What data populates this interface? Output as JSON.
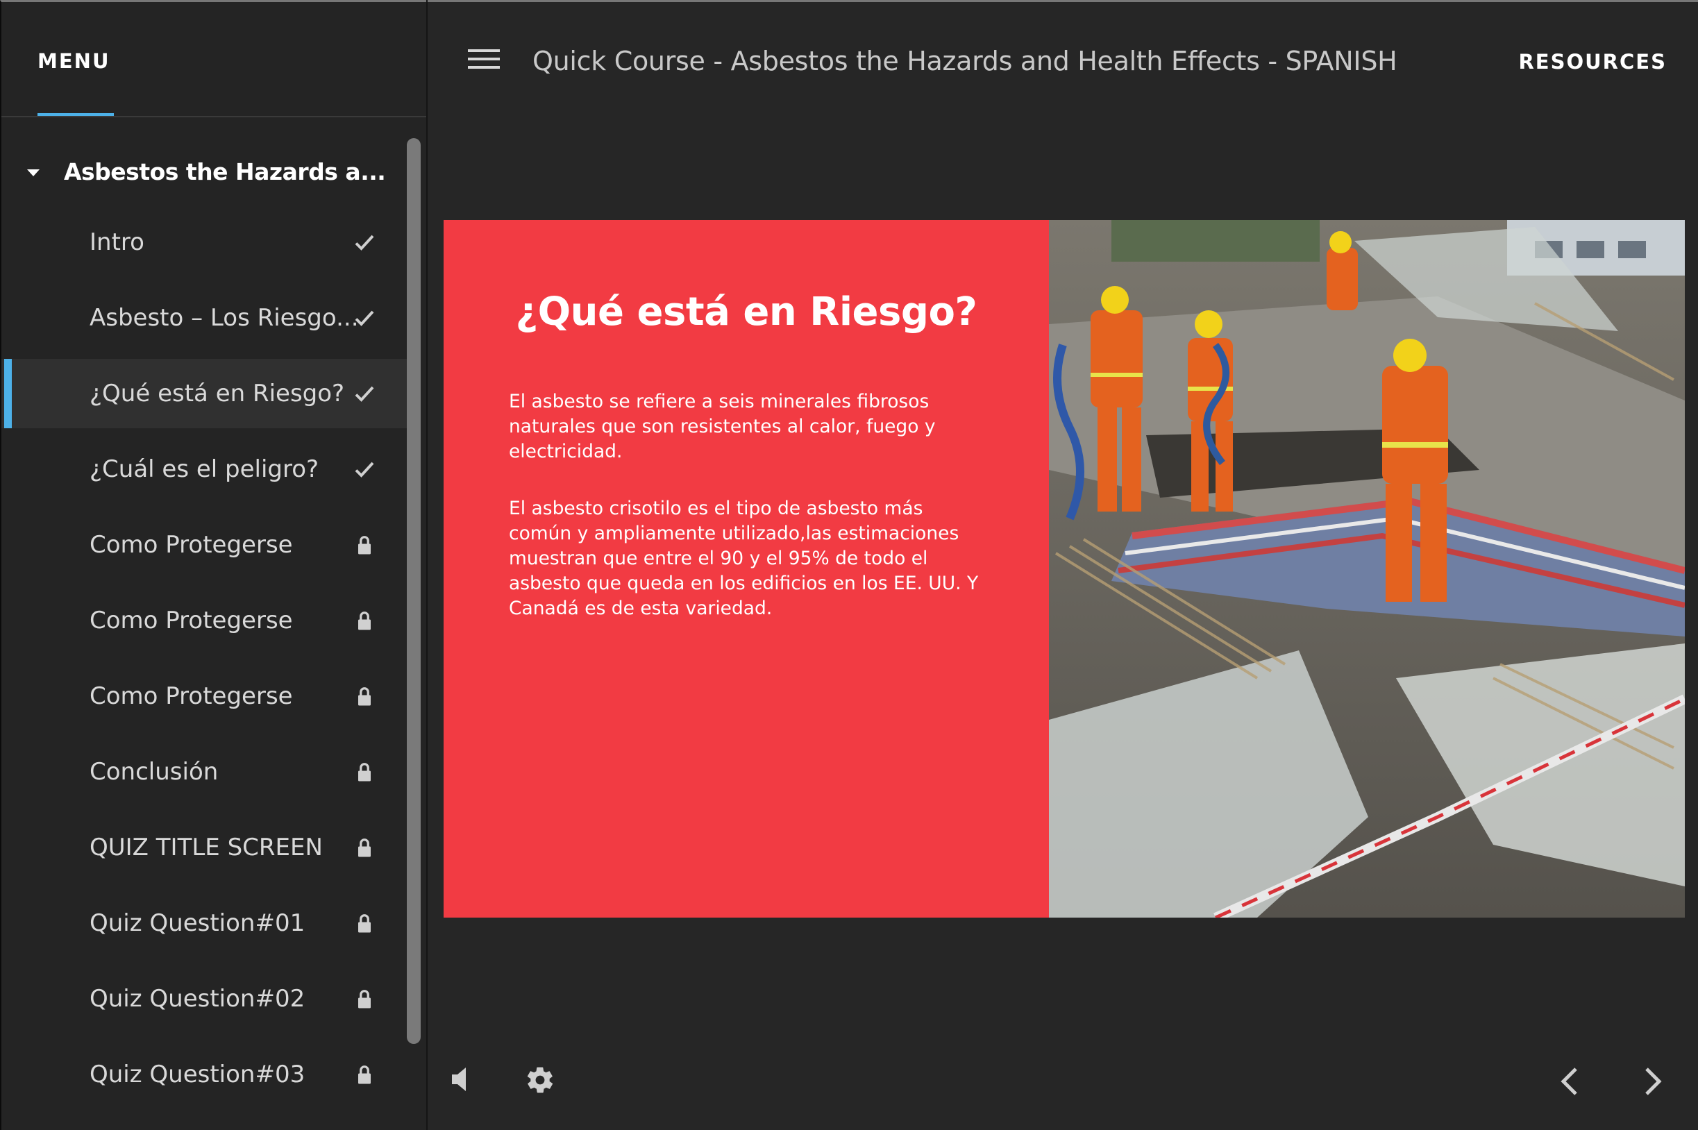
{
  "sidebar": {
    "menu_tab": "MENU",
    "section_title": "Asbestos the Hazards a...",
    "items": [
      {
        "label": "Intro",
        "status": "complete"
      },
      {
        "label": "Asbesto – Los Riesgo...",
        "status": "complete"
      },
      {
        "label": "¿Qué está en Riesgo?",
        "status": "complete"
      },
      {
        "label": "¿Cuál es el peligro?",
        "status": "complete"
      },
      {
        "label": "Como Protegerse",
        "status": "locked"
      },
      {
        "label": "Como Protegerse",
        "status": "locked"
      },
      {
        "label": "Como Protegerse",
        "status": "locked"
      },
      {
        "label": "Conclusión",
        "status": "locked"
      },
      {
        "label": "QUIZ TITLE SCREEN",
        "status": "locked"
      },
      {
        "label": "Quiz Question#01",
        "status": "locked"
      },
      {
        "label": "Quiz Question#02",
        "status": "locked"
      },
      {
        "label": "Quiz Question#03",
        "status": "locked"
      }
    ],
    "active_index": 2
  },
  "header": {
    "course_title": "Quick Course - Asbestos the Hazards and Health Effects - SPANISH",
    "resources_label": "RESOURCES"
  },
  "slide": {
    "heading": "¿Qué está en Riesgo?",
    "paragraph_1": "El asbesto se refiere a seis minerales fibrosos naturales que son resistentes al calor, fuego y electricidad.",
    "paragraph_2": "El asbesto crisotilo es el tipo de asbesto más común y ampliamente utilizado,las estimaciones muestran que entre el 90 y el 95% de todo el asbesto que queda en los edificios en los EE. UU. Y Canadá es de esta variedad.",
    "background_color": "#f23b43"
  },
  "controls": {
    "volume_icon": "volume-icon",
    "settings_icon": "gear-icon",
    "prev_icon": "chevron-left-icon",
    "next_icon": "chevron-right-icon"
  },
  "colors": {
    "accent": "#4db1e8",
    "sidebar_bg": "#242424",
    "main_bg": "#262626"
  }
}
